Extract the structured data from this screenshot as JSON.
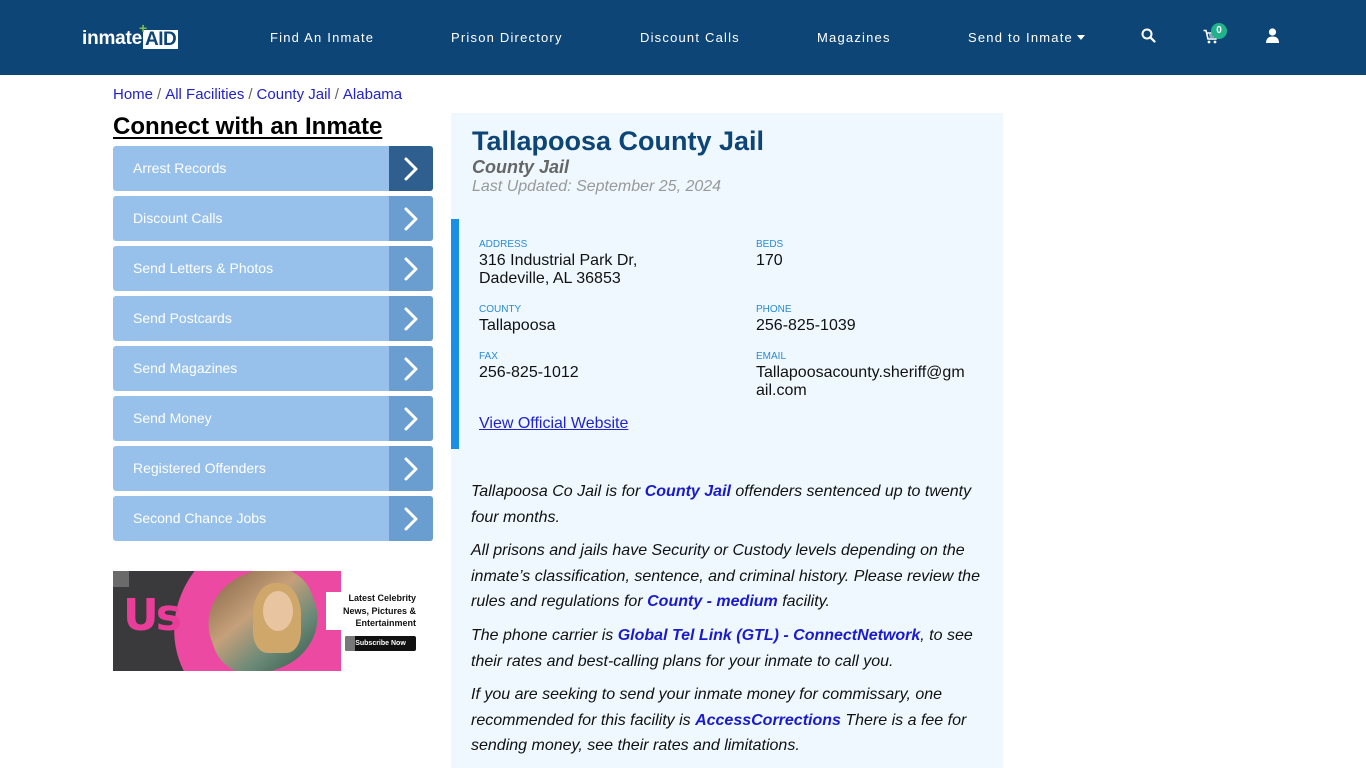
{
  "header": {
    "logo": {
      "text_main": "inmate",
      "text_accent": "AID",
      "plus": "+"
    },
    "nav": [
      {
        "label": "Find An Inmate"
      },
      {
        "label": "Prison Directory"
      },
      {
        "label": "Discount Calls"
      },
      {
        "label": "Magazines"
      },
      {
        "label": "Send to Inmate",
        "has_dropdown": true
      }
    ],
    "icons": {
      "search": "search-icon",
      "cart": "cart-icon",
      "user": "user-icon"
    },
    "cart_count": "0",
    "colors": {
      "navbar": "#0e4577",
      "badge": "#20b38a"
    }
  },
  "breadcrumb": [
    {
      "label": "Home"
    },
    {
      "label": "All Facilities"
    },
    {
      "label": "County Jail"
    },
    {
      "label": "Alabama"
    }
  ],
  "breadcrumb_separator": "/",
  "sidebar": {
    "title": "Connect with an Inmate",
    "items": [
      {
        "label": "Arrest Records",
        "active": true
      },
      {
        "label": "Discount Calls"
      },
      {
        "label": "Send Letters & Photos"
      },
      {
        "label": "Send Postcards"
      },
      {
        "label": "Send Magazines"
      },
      {
        "label": "Send Money"
      },
      {
        "label": "Registered Offenders"
      },
      {
        "label": "Second Chance Jobs"
      }
    ],
    "ad": {
      "brand": "Us",
      "tagline_lines": [
        "Latest Celebrity",
        "News, Pictures &",
        "Entertainment"
      ],
      "cta": "Subscribe Now"
    }
  },
  "facility": {
    "name": "Tallapoosa County Jail",
    "type": "County Jail",
    "last_updated": "Last Updated: September 25, 2024",
    "fields": {
      "address": {
        "label": "ADDRESS",
        "line1": "316 Industrial Park Dr,",
        "line2": "Dadeville, AL 36853"
      },
      "beds": {
        "label": "BEDS",
        "value": "170"
      },
      "county": {
        "label": "COUNTY",
        "value": "Tallapoosa"
      },
      "phone": {
        "label": "PHONE",
        "value": "256-825-1039"
      },
      "fax": {
        "label": "FAX",
        "value": "256-825-1012"
      },
      "email": {
        "label": "EMAIL",
        "line1": "Tallapoosacounty.sheriff@gm",
        "line2": "ail.com"
      }
    },
    "website_link": "View Official Website",
    "description": [
      {
        "before": "Tallapoosa Co Jail is for ",
        "link": "County Jail",
        "after": " offenders sentenced up to twenty four months."
      },
      {
        "before": "All prisons and jails have Security or Custody levels depending on the inmate’s classification, sentence, and criminal history. Please review the rules and regulations for ",
        "link": "County - medium",
        "after": " facility."
      },
      {
        "before": "The phone carrier is ",
        "link": "Global Tel Link (GTL) - ConnectNetwork",
        "after": ", to see their rates and best-calling plans for your inmate to call you."
      },
      {
        "before": "If you are seeking to send your inmate money for commissary, one recommended for this facility is ",
        "link": "AccessCorrections",
        "after": " There is a fee for sending money, see their rates and limitations."
      }
    ],
    "colors": {
      "title": "#0e4577",
      "card_bg": "#eef8fe",
      "accent_bar": "#1a8fe8",
      "link": "#1a1acc"
    }
  }
}
